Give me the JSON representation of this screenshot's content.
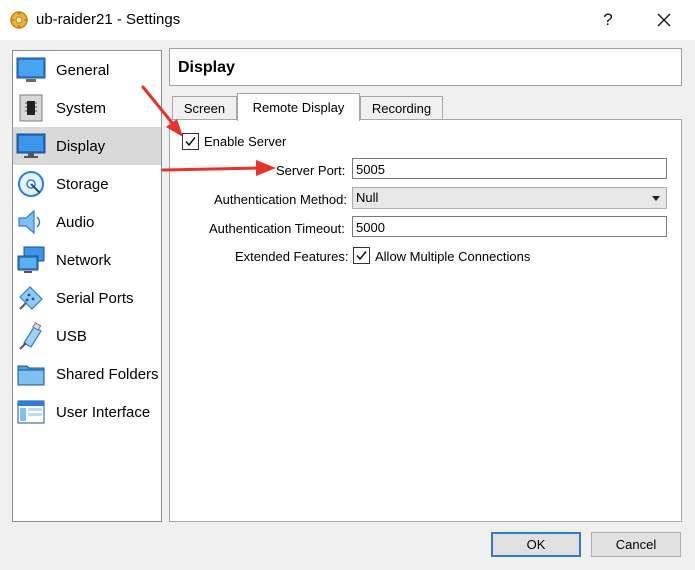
{
  "window": {
    "title": "ub-raider21 - Settings",
    "help_label": "?",
    "close_label": "✕"
  },
  "sidebar": {
    "items": [
      {
        "label": "General",
        "icon": "general-icon"
      },
      {
        "label": "System",
        "icon": "system-icon"
      },
      {
        "label": "Display",
        "icon": "display-icon",
        "selected": true
      },
      {
        "label": "Storage",
        "icon": "storage-icon"
      },
      {
        "label": "Audio",
        "icon": "audio-icon"
      },
      {
        "label": "Network",
        "icon": "network-icon"
      },
      {
        "label": "Serial Ports",
        "icon": "serial-ports-icon"
      },
      {
        "label": "USB",
        "icon": "usb-icon"
      },
      {
        "label": "Shared Folders",
        "icon": "shared-folders-icon"
      },
      {
        "label": "User Interface",
        "icon": "user-interface-icon"
      }
    ]
  },
  "page": {
    "title": "Display"
  },
  "tabs": [
    {
      "label": "Screen"
    },
    {
      "label": "Remote Display",
      "active": true
    },
    {
      "label": "Recording"
    }
  ],
  "remote_display": {
    "enable_server_label": "Enable Server",
    "enable_server_checked": true,
    "server_port_label": "Server Port:",
    "server_port_value": "5005",
    "auth_method_label": "Authentication Method:",
    "auth_method_value": "Null",
    "auth_timeout_label": "Authentication Timeout:",
    "auth_timeout_value": "5000",
    "extended_features_label": "Extended Features:",
    "allow_multiple_label": "Allow Multiple Connections",
    "allow_multiple_checked": true
  },
  "buttons": {
    "ok_label": "OK",
    "cancel_label": "Cancel"
  },
  "annotations": {
    "arrow_color": "#e8322c"
  }
}
